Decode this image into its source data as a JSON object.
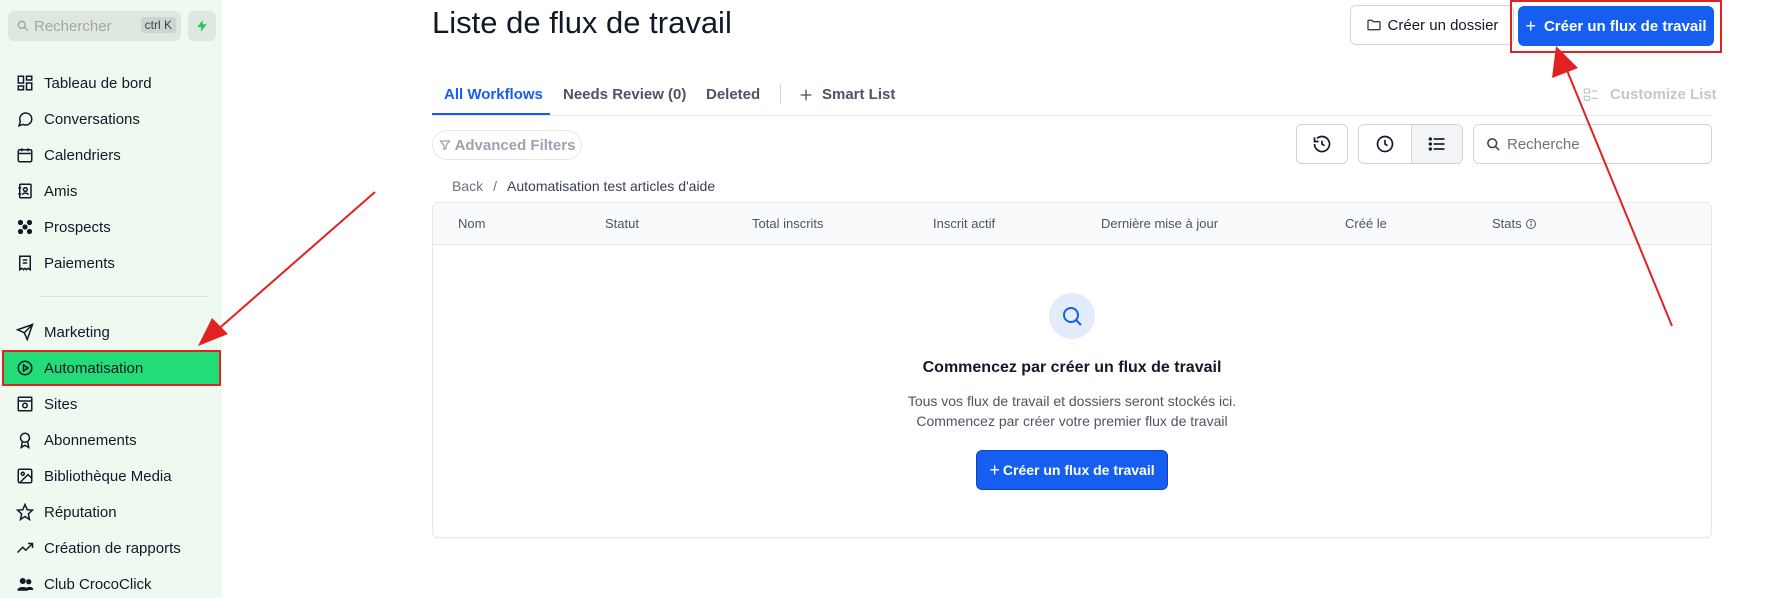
{
  "sidebar": {
    "search_placeholder": "Rechercher",
    "search_shortcut": "ctrl K",
    "items": [
      {
        "label": "Tableau de bord",
        "icon": "dashboard-icon"
      },
      {
        "label": "Conversations",
        "icon": "chat-icon"
      },
      {
        "label": "Calendriers",
        "icon": "calendar-icon"
      },
      {
        "label": "Amis",
        "icon": "contacts-icon"
      },
      {
        "label": "Prospects",
        "icon": "prospects-icon"
      },
      {
        "label": "Paiements",
        "icon": "payments-icon"
      },
      {
        "label": "Marketing",
        "icon": "send-icon"
      },
      {
        "label": "Automatisation",
        "icon": "automation-icon",
        "active": true
      },
      {
        "label": "Sites",
        "icon": "sites-icon"
      },
      {
        "label": "Abonnements",
        "icon": "award-icon"
      },
      {
        "label": "Bibliothèque Media",
        "icon": "image-icon"
      },
      {
        "label": "Réputation",
        "icon": "star-icon"
      },
      {
        "label": "Création de rapports",
        "icon": "trending-icon"
      },
      {
        "label": "Club CrocoClick",
        "icon": "users-icon"
      }
    ],
    "accent_color": "#22dd77"
  },
  "header": {
    "title": "Liste de flux de travail",
    "create_folder_label": "Créer un dossier",
    "create_workflow_label": "Créer un flux de travail"
  },
  "tabs": {
    "all": "All Workflows",
    "review": "Needs Review (0)",
    "deleted": "Deleted",
    "smart_list": "Smart List",
    "customize": "Customize List"
  },
  "filters": {
    "advanced": "Advanced Filters",
    "search_placeholder": "Recherche"
  },
  "breadcrumb": {
    "back": "Back",
    "separator": "/",
    "current": "Automatisation test articles d'aide"
  },
  "table": {
    "columns": [
      "Nom",
      "Statut",
      "Total inscrits",
      "Inscrit actif",
      "Dernière mise à jour",
      "Créé le",
      "Stats"
    ]
  },
  "empty_state": {
    "title": "Commencez par créer un flux de travail",
    "line1": "Tous vos flux de travail et dossiers seront stockés ici.",
    "line2": "Commencez par créer votre premier flux de travail",
    "button": "Créer un flux de travail"
  },
  "colors": {
    "primary": "#155eef",
    "annotation": "#e02222"
  }
}
